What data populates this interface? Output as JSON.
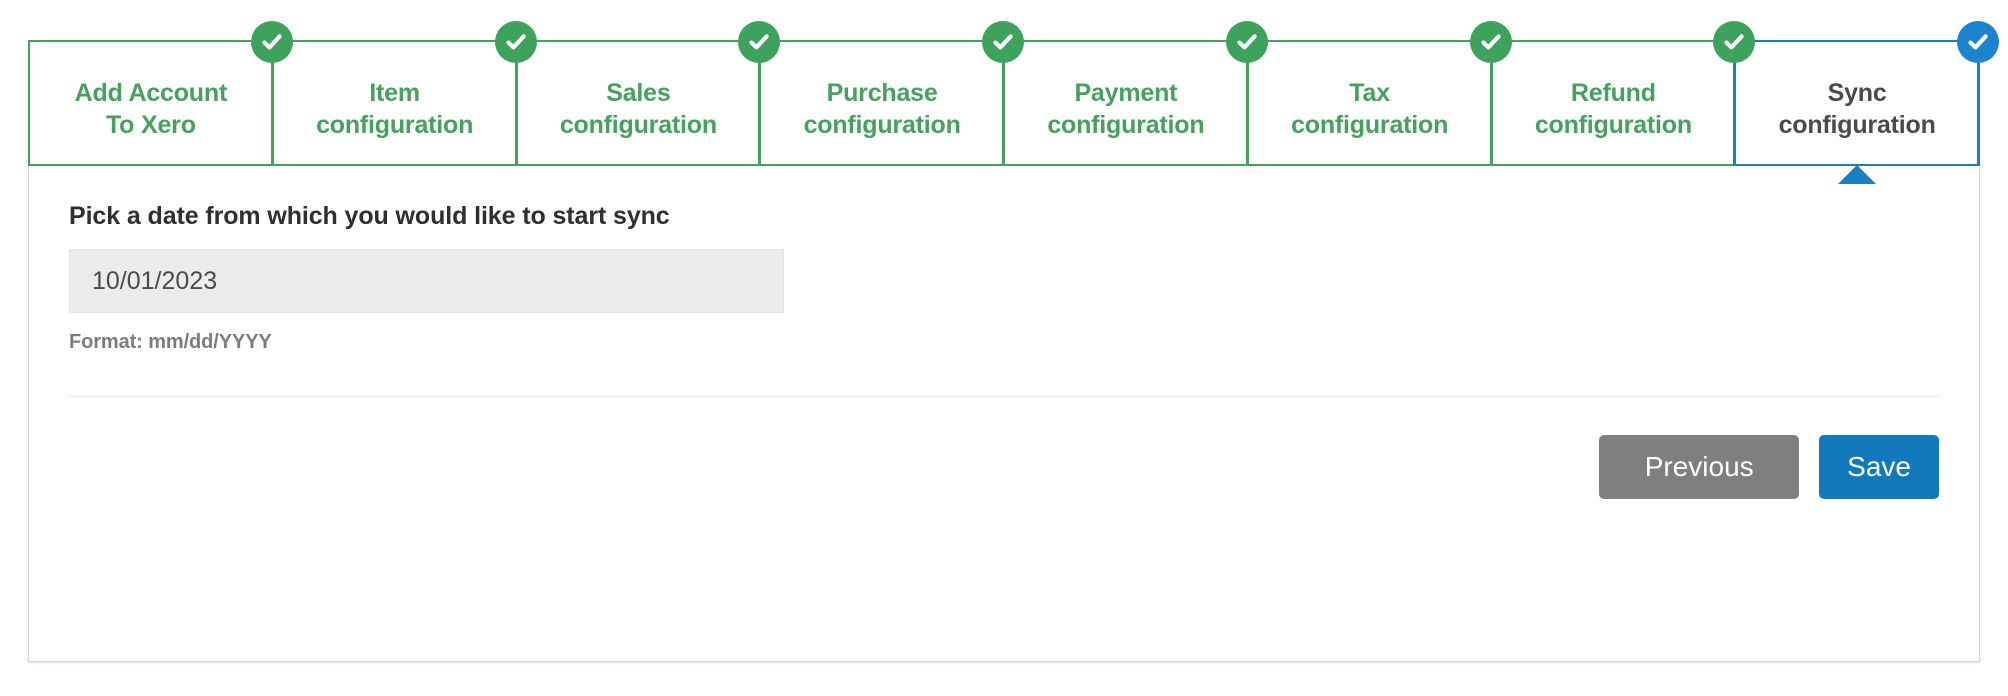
{
  "wizard": {
    "steps": [
      {
        "id": "add-account-to-xero",
        "label": "Add Account\nTo Xero",
        "state": "completed",
        "marker_icon": "check-circle-icon"
      },
      {
        "id": "item-configuration",
        "label": "Item\nconfiguration",
        "state": "completed",
        "marker_icon": "check-circle-icon"
      },
      {
        "id": "sales-configuration",
        "label": "Sales\nconfiguration",
        "state": "completed",
        "marker_icon": "check-circle-icon"
      },
      {
        "id": "purchase-configuration",
        "label": "Purchase\nconfiguration",
        "state": "completed",
        "marker_icon": "check-circle-icon"
      },
      {
        "id": "payment-configuration",
        "label": "Payment\nconfiguration",
        "state": "completed",
        "marker_icon": "check-circle-icon"
      },
      {
        "id": "tax-configuration",
        "label": "Tax\nconfiguration",
        "state": "completed",
        "marker_icon": "check-circle-icon"
      },
      {
        "id": "refund-configuration",
        "label": "Refund\nconfiguration",
        "state": "completed",
        "marker_icon": "check-circle-icon"
      },
      {
        "id": "sync-configuration",
        "label": "Sync\nconfiguration",
        "state": "active",
        "marker_icon": "check-circle-icon"
      }
    ],
    "colors": {
      "completed": "#46a15c",
      "completed_marker": "#3da25b",
      "active": "#1c7fc3",
      "active_marker": "#1c84cd",
      "active_label": "#4a4a4a"
    }
  },
  "form": {
    "date_question": "Pick a date from which you would like to start sync",
    "date_value": "10/01/2023",
    "date_placeholder": "mm/dd/YYYY",
    "format_hint": "Format: mm/dd/YYYY"
  },
  "actions": {
    "previous_label": "Previous",
    "save_label": "Save",
    "previous_color": "#7f7f7f",
    "save_color": "#1279bd"
  }
}
